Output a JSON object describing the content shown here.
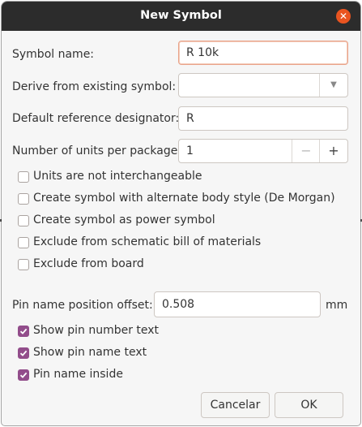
{
  "dialog": {
    "title": "New Symbol",
    "close_icon": "close-icon",
    "accent_color": "#e95420",
    "check_color": "#924d8b"
  },
  "fields": {
    "symbol_name_label": "Symbol name:",
    "symbol_name_value": "R 10k",
    "derive_label": "Derive from existing symbol:",
    "derive_value": "",
    "ref_label": "Default reference designator:",
    "ref_value": "R",
    "units_label": "Number of units per package:",
    "units_value": "1",
    "spin_minus": "−",
    "spin_plus": "+",
    "pin_offset_label": "Pin name position offset:",
    "pin_offset_value": "0.508",
    "pin_offset_unit": "mm"
  },
  "options": [
    {
      "label": "Units are not interchangeable",
      "checked": false
    },
    {
      "label": "Create symbol with alternate body style (De Morgan)",
      "checked": false
    },
    {
      "label": "Create symbol as power symbol",
      "checked": false
    },
    {
      "label": "Exclude from schematic bill of materials",
      "checked": false
    },
    {
      "label": "Exclude from board",
      "checked": false
    }
  ],
  "pin_options": [
    {
      "label": "Show pin number text",
      "checked": true
    },
    {
      "label": "Show pin name text",
      "checked": true
    },
    {
      "label": "Pin name inside",
      "checked": true
    }
  ],
  "buttons": {
    "cancel": "Cancelar",
    "ok": "OK"
  }
}
